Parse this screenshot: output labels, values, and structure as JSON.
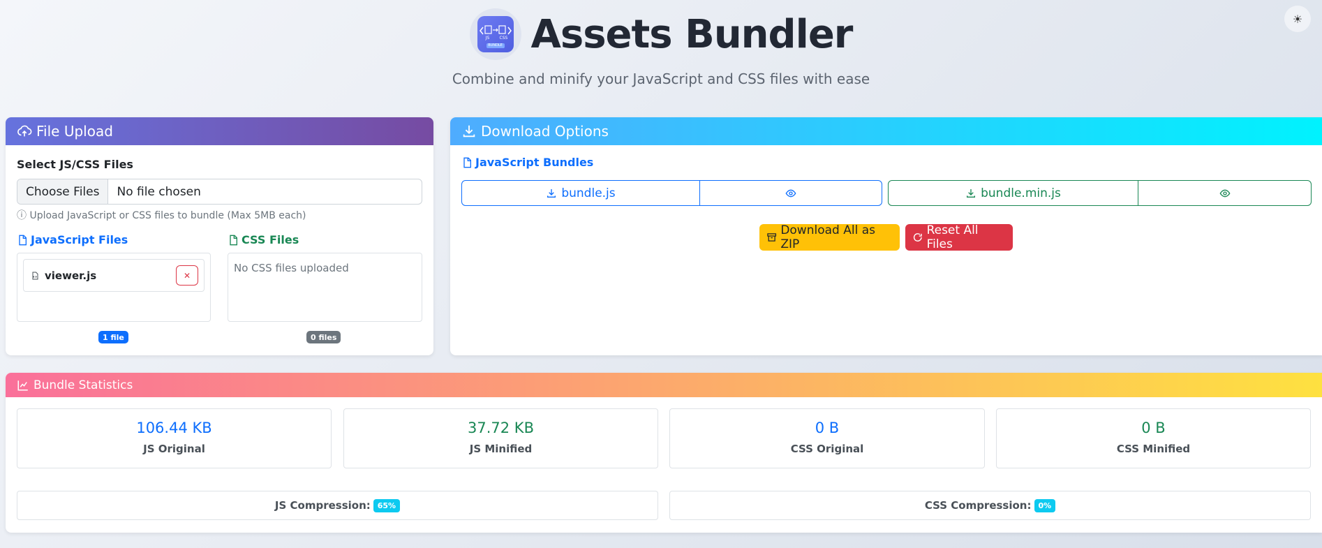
{
  "header": {
    "title": "Assets Bundler",
    "subtitle": "Combine and minify your JavaScript and CSS files with ease",
    "logo_text": {
      "js": "JS",
      "css": "CSS",
      "bundle": "BUNDLE"
    },
    "theme_icon": "sun-icon"
  },
  "upload": {
    "title": "File Upload",
    "select_label": "Select JS/CSS Files",
    "choose_button": "Choose Files",
    "chosen_text": "No file chosen",
    "help_text": "Upload JavaScript or CSS files to bundle (Max 5MB each)",
    "js_section": {
      "title": "JavaScript Files",
      "files": [
        {
          "name": "viewer.js"
        }
      ],
      "count_badge": "1 file"
    },
    "css_section": {
      "title": "CSS Files",
      "empty_text": "No CSS files uploaded",
      "count_badge": "0 files"
    }
  },
  "download": {
    "title": "Download Options",
    "js_bundles_title": "JavaScript Bundles",
    "bundle_label": "bundle.js",
    "bundle_min_label": "bundle.min.js",
    "download_zip_label": "Download All as ZIP",
    "reset_label": "Reset All Files"
  },
  "stats": {
    "title": "Bundle Statistics",
    "items": [
      {
        "value": "106.44 KB",
        "label": "JS Original"
      },
      {
        "value": "37.72 KB",
        "label": "JS Minified"
      },
      {
        "value": "0 B",
        "label": "CSS Original"
      },
      {
        "value": "0 B",
        "label": "CSS Minified"
      }
    ],
    "js_compression_label": "JS Compression:",
    "js_compression_value": "65%",
    "css_compression_label": "CSS Compression:",
    "css_compression_value": "0%"
  },
  "colors": {
    "primary": "#0d6efd",
    "success": "#198754",
    "danger": "#dc3545",
    "warning": "#ffc107",
    "info": "#0dcaf0",
    "secondary": "#6c757d"
  }
}
